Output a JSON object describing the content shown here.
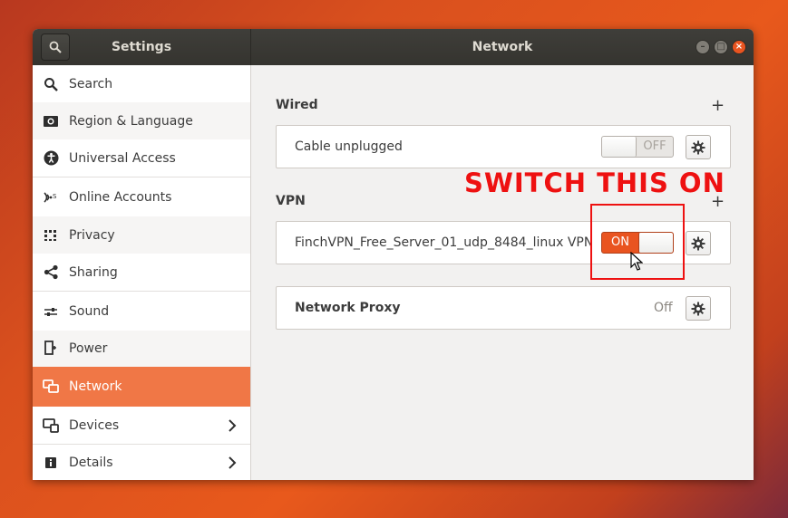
{
  "window": {
    "sidebar_title": "Settings",
    "main_title": "Network",
    "controls": {
      "minimize": "–",
      "maximize": "□",
      "close": "×"
    }
  },
  "sidebar": {
    "items": [
      {
        "label": "Search",
        "icon": "search-icon"
      },
      {
        "label": "Region & Language",
        "icon": "region-language-icon"
      },
      {
        "label": "Universal Access",
        "icon": "universal-access-icon"
      },
      {
        "label": "Online Accounts",
        "icon": "online-accounts-icon"
      },
      {
        "label": "Privacy",
        "icon": "privacy-icon"
      },
      {
        "label": "Sharing",
        "icon": "sharing-icon"
      },
      {
        "label": "Sound",
        "icon": "sound-icon"
      },
      {
        "label": "Power",
        "icon": "power-icon"
      },
      {
        "label": "Network",
        "icon": "network-icon",
        "active": true
      },
      {
        "label": "Devices",
        "icon": "devices-icon",
        "has_submenu": true
      },
      {
        "label": "Details",
        "icon": "details-icon",
        "has_submenu": true
      }
    ]
  },
  "main": {
    "wired": {
      "title": "Wired",
      "add_label": "+",
      "row_label": "Cable unplugged",
      "toggle_text": "OFF",
      "toggle_state": "off"
    },
    "vpn": {
      "title": "VPN",
      "add_label": "+",
      "row_label": "FinchVPN_Free_Server_01_udp_8484_linux VPN",
      "toggle_text": "ON",
      "toggle_state": "on"
    },
    "proxy": {
      "label": "Network Proxy",
      "value": "Off"
    }
  },
  "annotation": {
    "text": "SWITCH THIS ON",
    "color": "#ee1111"
  },
  "colors": {
    "accent": "#e95420",
    "sidebar_active": "#f07746",
    "titlebar": "#3a3935"
  }
}
